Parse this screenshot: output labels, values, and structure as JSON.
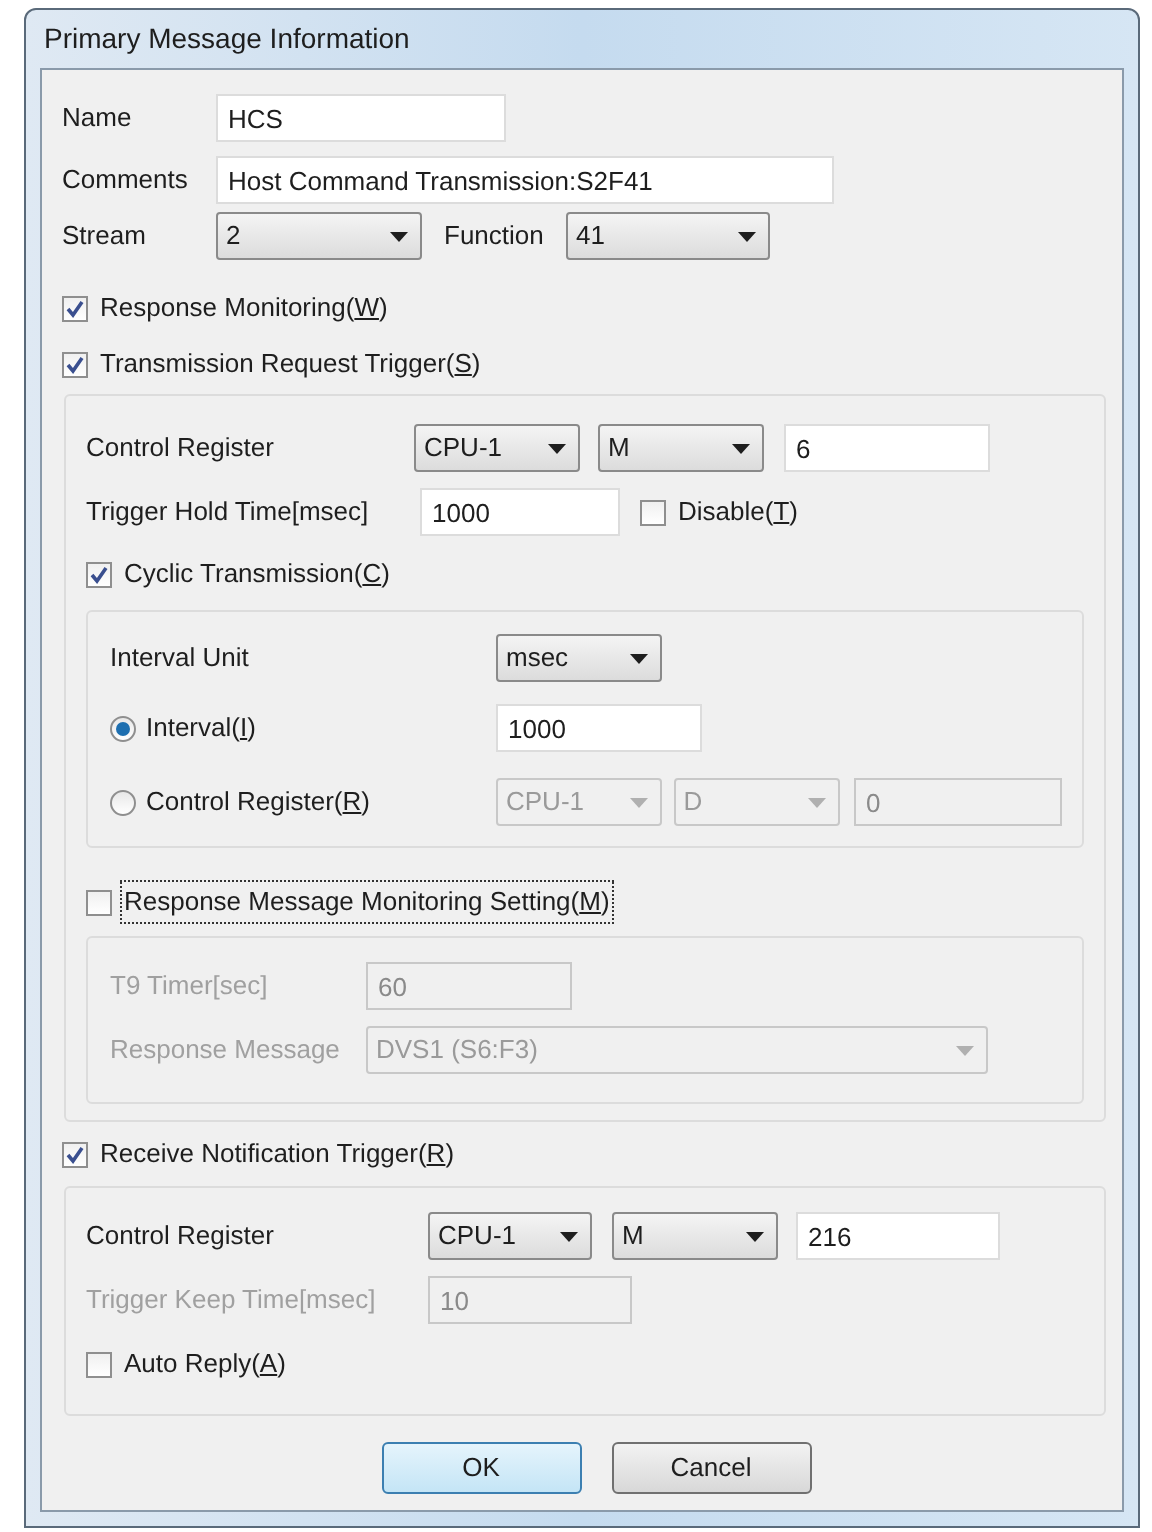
{
  "window": {
    "title": "Primary Message Information"
  },
  "name": {
    "label": "Name",
    "value": "HCS"
  },
  "comments": {
    "label": "Comments",
    "value": "Host Command Transmission:S2F41"
  },
  "stream": {
    "label": "Stream",
    "value": "2"
  },
  "function": {
    "label": "Function",
    "value": "41"
  },
  "response_monitoring": {
    "label": "Response Monitoring(W)",
    "checked": true
  },
  "transmission_request_trigger": {
    "label": "Transmission Request Trigger(S)",
    "checked": true,
    "control_register": {
      "label": "Control Register",
      "cpu": "CPU-1",
      "device": "M",
      "address": "6"
    },
    "trigger_hold_time": {
      "label": "Trigger Hold Time[msec]",
      "value": "1000"
    },
    "disable": {
      "label": "Disable(T)",
      "checked": false
    },
    "cyclic_transmission": {
      "label": "Cyclic Transmission(C)",
      "checked": true,
      "interval_unit": {
        "label": "Interval Unit",
        "value": "msec"
      },
      "options": [
        {
          "kind": "interval",
          "label": "Interval(I)",
          "selected": true,
          "value": "1000"
        },
        {
          "kind": "register",
          "label": "Control Register(R)",
          "selected": false,
          "cpu": "CPU-1",
          "device": "D",
          "address": "0"
        }
      ]
    },
    "response_message_monitoring": {
      "label": "Response Message Monitoring Setting(M)",
      "checked": false,
      "focused": true,
      "t9_timer": {
        "label": "T9 Timer[sec]",
        "value": "60"
      },
      "response_message": {
        "label": "Response Message",
        "value": "DVS1 (S6:F3)"
      }
    }
  },
  "receive_notification_trigger": {
    "label": "Receive Notification Trigger(R)",
    "checked": true,
    "control_register": {
      "label": "Control Register",
      "cpu": "CPU-1",
      "device": "M",
      "address": "216"
    },
    "trigger_keep_time": {
      "label": "Trigger Keep Time[msec]",
      "value": "10",
      "disabled": true
    },
    "auto_reply": {
      "label": "Auto Reply(A)",
      "checked": false
    }
  },
  "buttons": [
    {
      "label": "OK",
      "default": true
    },
    {
      "label": "Cancel",
      "default": false
    }
  ]
}
